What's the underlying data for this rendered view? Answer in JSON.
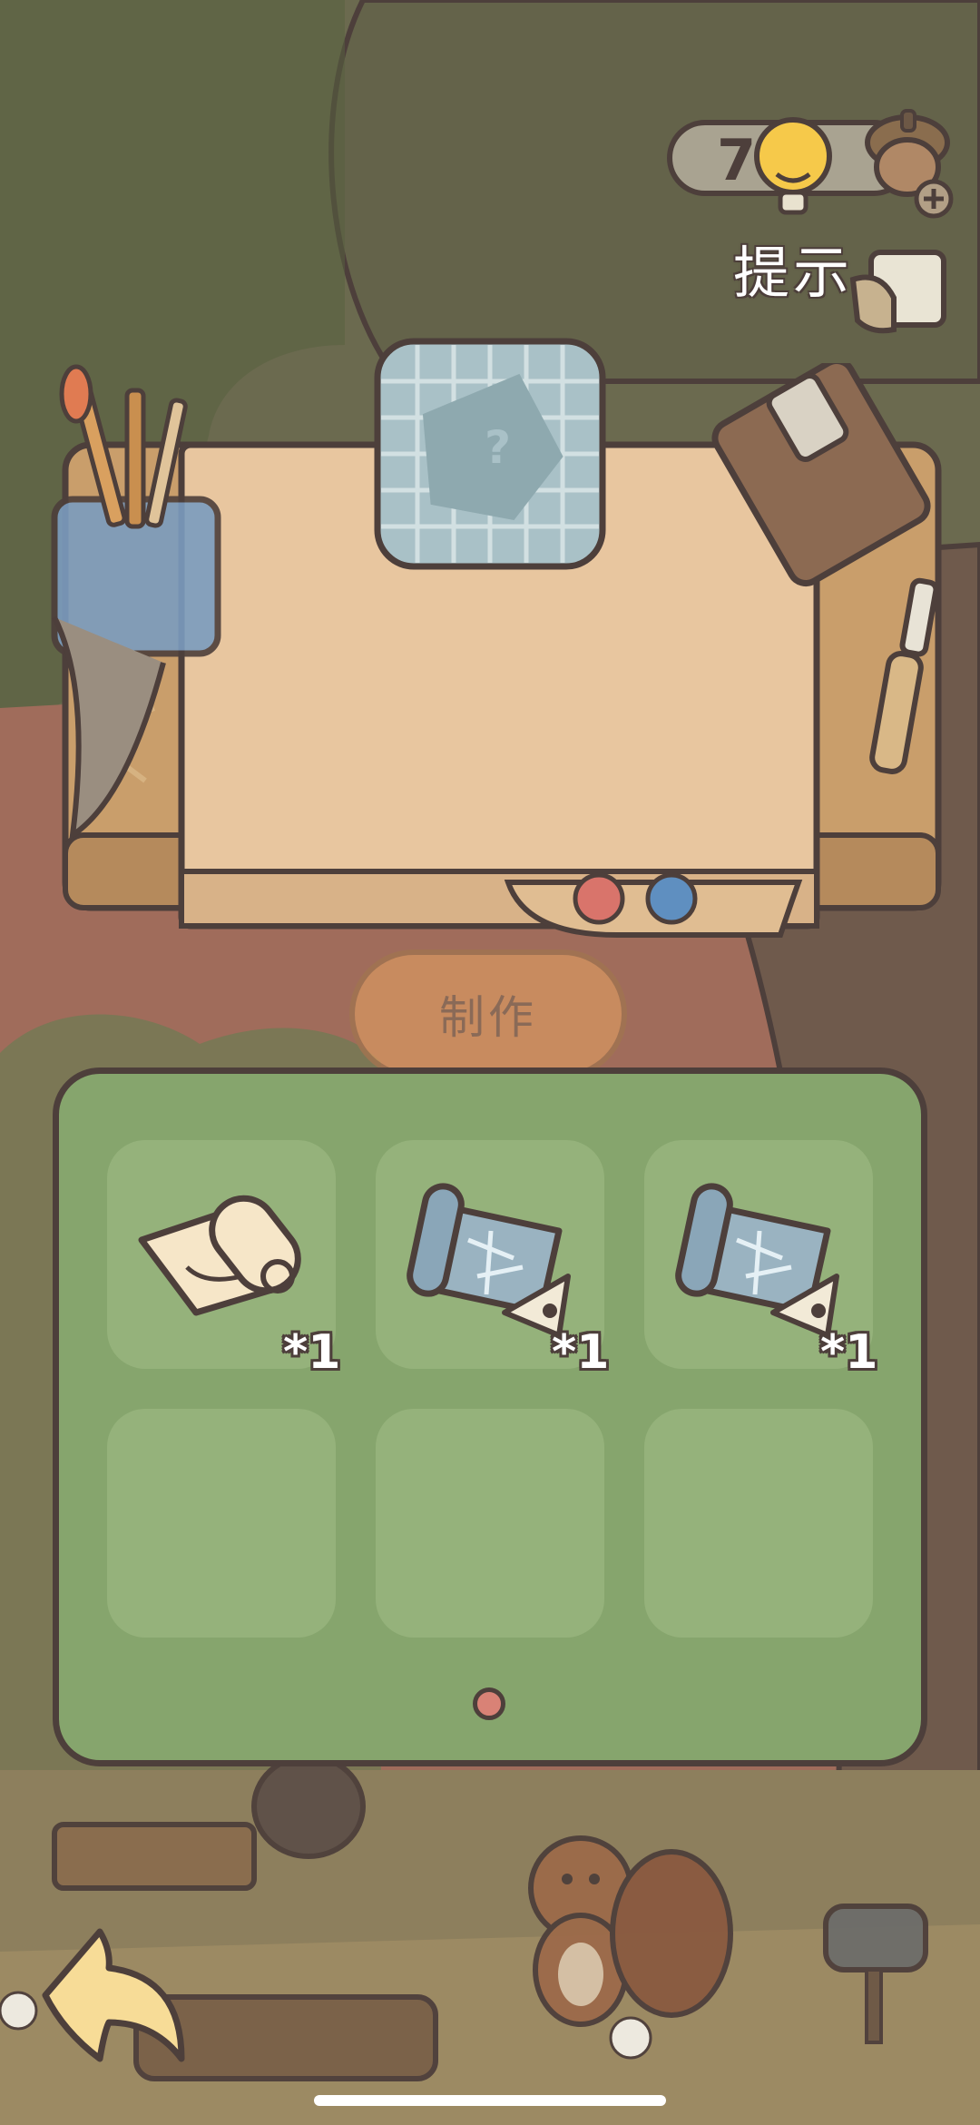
{
  "hud": {
    "hint_count": "7",
    "hint_label": "提示"
  },
  "crafting": {
    "make_button_label": "制作",
    "result_placeholder_icon": "question-mark-paper-icon"
  },
  "inventory": {
    "slots": [
      {
        "item_icon": "paper-scroll-icon",
        "count": "*1"
      },
      {
        "item_icon": "blueprint-ruler-icon",
        "count": "*1"
      },
      {
        "item_icon": "blueprint-ruler-icon",
        "count": "*1"
      },
      {
        "item_icon": "",
        "count": ""
      },
      {
        "item_icon": "",
        "count": ""
      },
      {
        "item_icon": "",
        "count": ""
      }
    ],
    "current_page": 1,
    "total_pages": 1
  },
  "colors": {
    "panel_green": "#86a56d",
    "slot_green": "#95b27b",
    "outline": "#4d3f3b",
    "desk_paper": "#e8c69f",
    "make_button": "#d69660"
  }
}
